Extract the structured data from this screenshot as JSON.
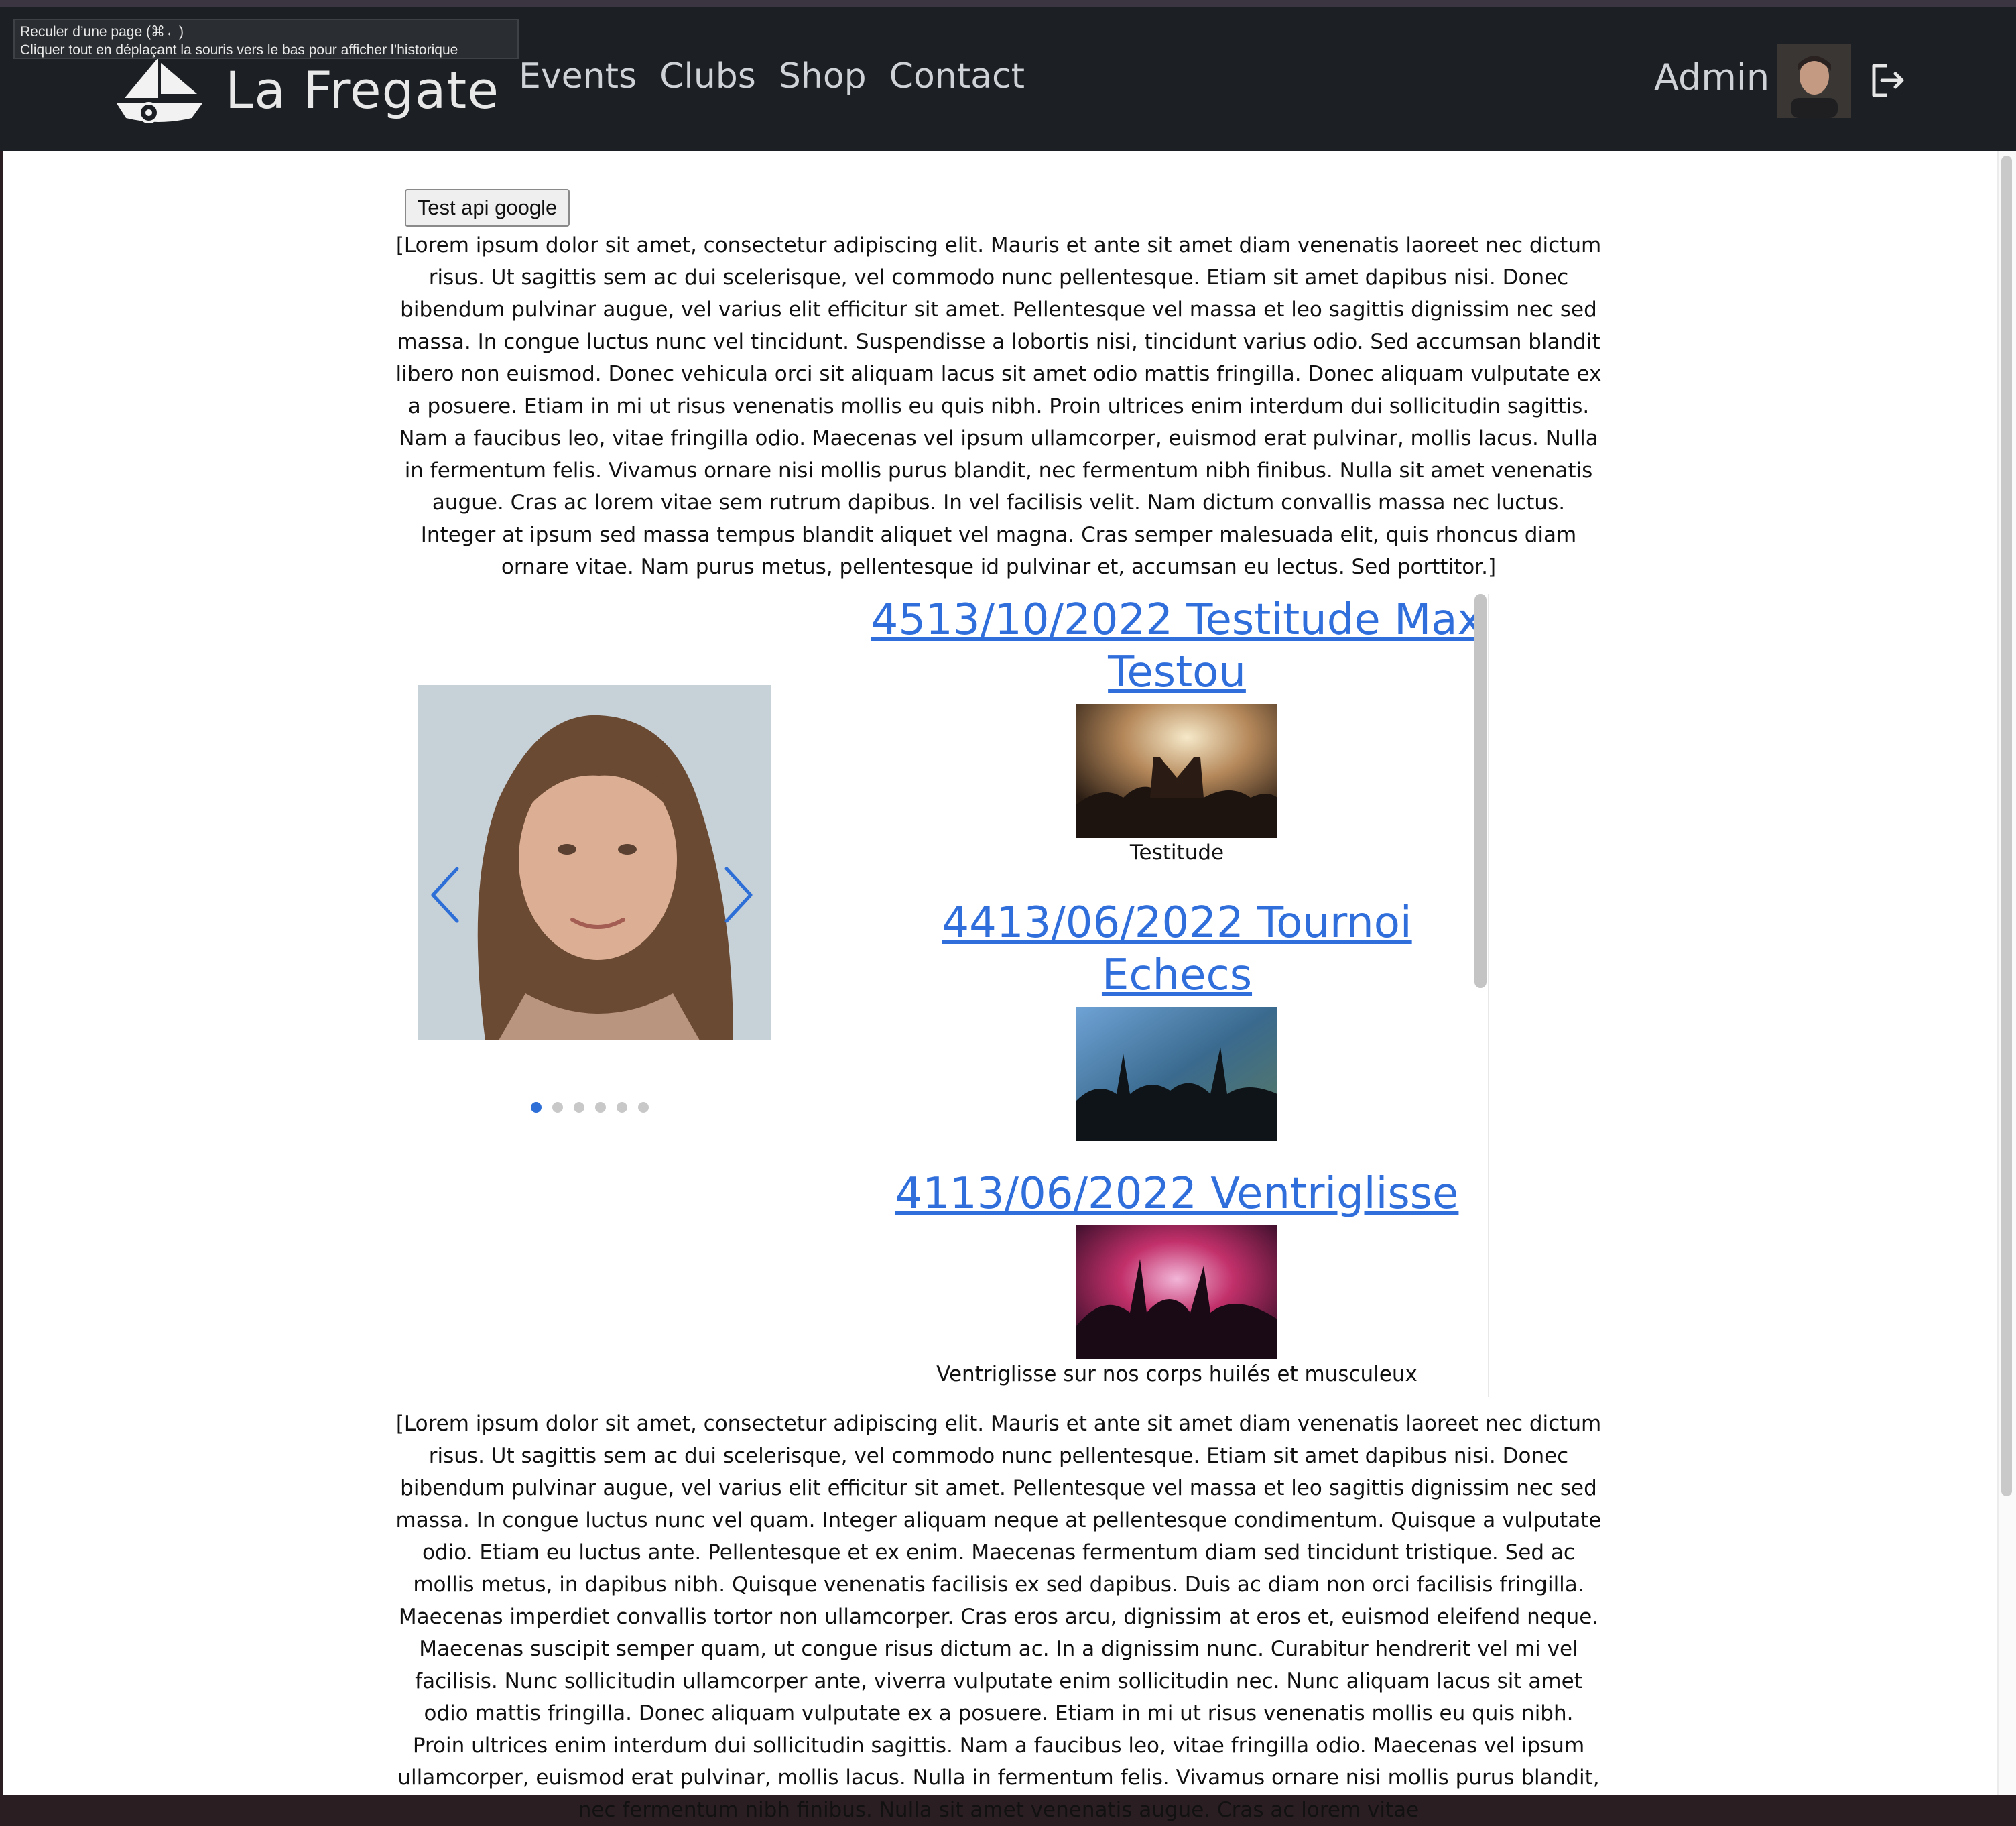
{
  "browser": {
    "back_tooltip_line1": "Reculer d’une page (⌘←)",
    "back_tooltip_line2": "Cliquer tout en déplaçant la souris vers le bas pour afficher l’historique"
  },
  "nav": {
    "brand": "La Fregate",
    "links": [
      "Events",
      "Clubs",
      "Shop",
      "Contact"
    ],
    "user": "Admin"
  },
  "main": {
    "test_button": "Test api google",
    "intro_text": "[Lorem ipsum dolor sit amet, consectetur adipiscing elit. Mauris et ante sit amet diam venenatis laoreet nec dictum risus. Ut sagittis sem ac dui scelerisque, vel commodo nunc pellentesque. Etiam sit amet dapibus nisi. Donec bibendum pulvinar augue, vel varius elit efficitur sit amet. Pellentesque vel massa et leo sagittis dignissim nec sed massa. In congue luctus nunc vel tincidunt. Suspendisse a lobortis nisi, tincidunt varius odio. Sed accumsan blandit libero non euismod. Donec vehicula orci sit aliquam lacus sit amet odio mattis fringilla. Donec aliquam vulputate ex a posuere. Etiam in mi ut risus venenatis mollis eu quis nibh. Proin ultrices enim interdum dui sollicitudin sagittis. Nam a faucibus leo, vitae fringilla odio. Maecenas vel ipsum ullamcorper, euismod erat pulvinar, mollis lacus. Nulla in fermentum felis. Vivamus ornare nisi mollis purus blandit, nec fermentum nibh finibus. Nulla sit amet venenatis augue. Cras ac lorem vitae sem rutrum dapibus. In vel facilisis velit. Nam dictum convallis massa nec luctus. Integer at ipsum sed massa tempus blandit aliquet vel magna. Cras semper malesuada elit, quis rhoncus diam ornare vitae. Nam purus metus, pellentesque id pulvinar et, accumsan eu lectus. Sed porttitor.]",
    "outro_text": "[Lorem ipsum dolor sit amet, consectetur adipiscing elit. Mauris et ante sit amet diam venenatis laoreet nec dictum risus. Ut sagittis sem ac dui scelerisque, vel commodo nunc pellentesque. Etiam sit amet dapibus nisi. Donec bibendum pulvinar augue, vel varius elit efficitur sit amet. Pellentesque vel massa et leo sagittis dignissim nec sed massa. In congue luctus nunc vel quam. Integer aliquam neque at pellentesque condimentum. Quisque a vulputate odio. Etiam eu luctus ante. Pellentesque et ex enim. Maecenas fermentum diam sed tincidunt tristique. Sed ac mollis metus, in dapibus nibh. Quisque venenatis facilisis ex sed dapibus. Duis ac diam non orci facilisis fringilla. Maecenas imperdiet convallis tortor non ullamcorper. Cras eros arcu, dignissim at eros et, euismod eleifend neque. Maecenas suscipit semper quam, ut congue risus dictum ac. In a dignissim nunc. Curabitur hendrerit vel mi vel facilisis. Nunc sollicitudin ullamcorper ante, viverra vulputate enim sollicitudin nec. Nunc aliquam lacus sit amet odio mattis fringilla. Donec aliquam vulputate ex a posuere. Etiam in mi ut risus venenatis mollis eu quis nibh. Proin ultrices enim interdum dui sollicitudin sagittis. Nam a faucibus leo, vitae fringilla odio. Maecenas vel ipsum ullamcorper, euismod erat pulvinar, mollis lacus. Nulla in fermentum felis. Vivamus ornare nisi mollis purus blandit, nec fermentum nibh finibus. Nulla sit amet venenatis augue. Cras ac lorem vitae"
  },
  "carousel": {
    "slide_count": 6,
    "active_index": 0
  },
  "events": [
    {
      "title": "4513/10/2022 Testitude Max Testou",
      "caption": "Testitude"
    },
    {
      "title": "4413/06/2022 Tournoi Echecs",
      "caption": ""
    },
    {
      "title": "4113/06/2022 Ventriglisse",
      "caption": "Ventriglisse sur nos corps huilés et musculeux"
    }
  ],
  "colors": {
    "navbar": "#1c2024",
    "link": "#2f6edb",
    "nav_text": "#cfd2d6"
  }
}
